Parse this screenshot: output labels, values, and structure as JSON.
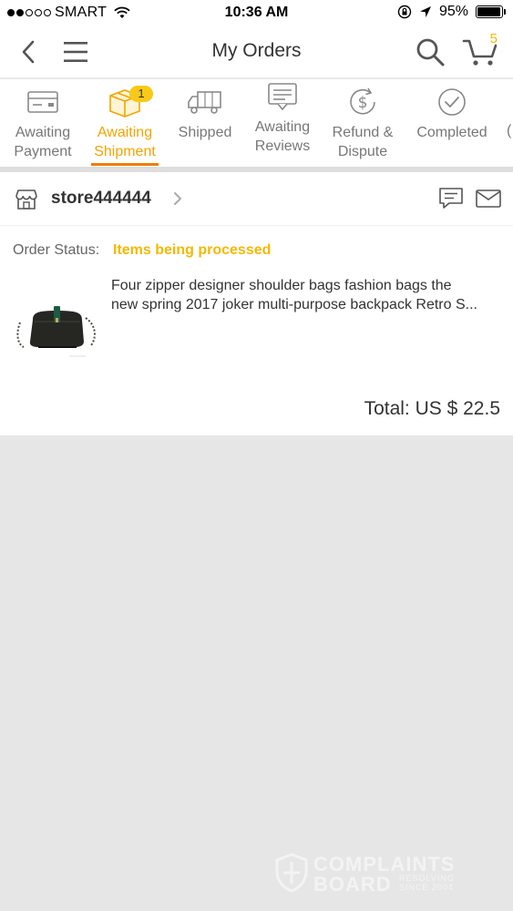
{
  "status_bar": {
    "carrier": "SMART",
    "time": "10:36 AM",
    "battery": "95%",
    "battery_level": 0.95,
    "signal_bars_filled": 2,
    "signal_bars_total": 5
  },
  "nav": {
    "title": "My Orders",
    "cart_count": "5"
  },
  "tabs": [
    {
      "line1": "Awaiting",
      "line2": "Payment",
      "icon": "credit-card-icon"
    },
    {
      "line1": "Awaiting",
      "line2": "Shipment",
      "icon": "box-icon",
      "badge": "1",
      "active": true
    },
    {
      "line1": "Shipped",
      "line2": "",
      "icon": "truck-icon"
    },
    {
      "line1": "Awaiting",
      "line2": "Reviews",
      "icon": "review-icon"
    },
    {
      "line1": "Refund &",
      "line2": "Dispute",
      "icon": "refund-icon"
    },
    {
      "line1": "Completed",
      "line2": "",
      "icon": "check-circle-icon"
    }
  ],
  "order": {
    "store_name": "store444444",
    "status_label": "Order Status:",
    "status_value": "Items being processed",
    "product_title_line1": "Four zipper designer shoulder bags fashion bags the",
    "product_title_line2": "new spring 2017 joker multi-purpose backpack Retro S...",
    "total": "Total: US $ 22.5"
  },
  "watermark": {
    "line1": "COMPLAINTS",
    "line2": "BOARD",
    "tag1": "RESOLVING",
    "tag2": "SINCE 2004"
  },
  "colors": {
    "accent": "#f5b800",
    "active_tab": "#f5a300",
    "underline": "#f07c00",
    "badge": "#f8c91a",
    "background": "#e6e6e6"
  }
}
